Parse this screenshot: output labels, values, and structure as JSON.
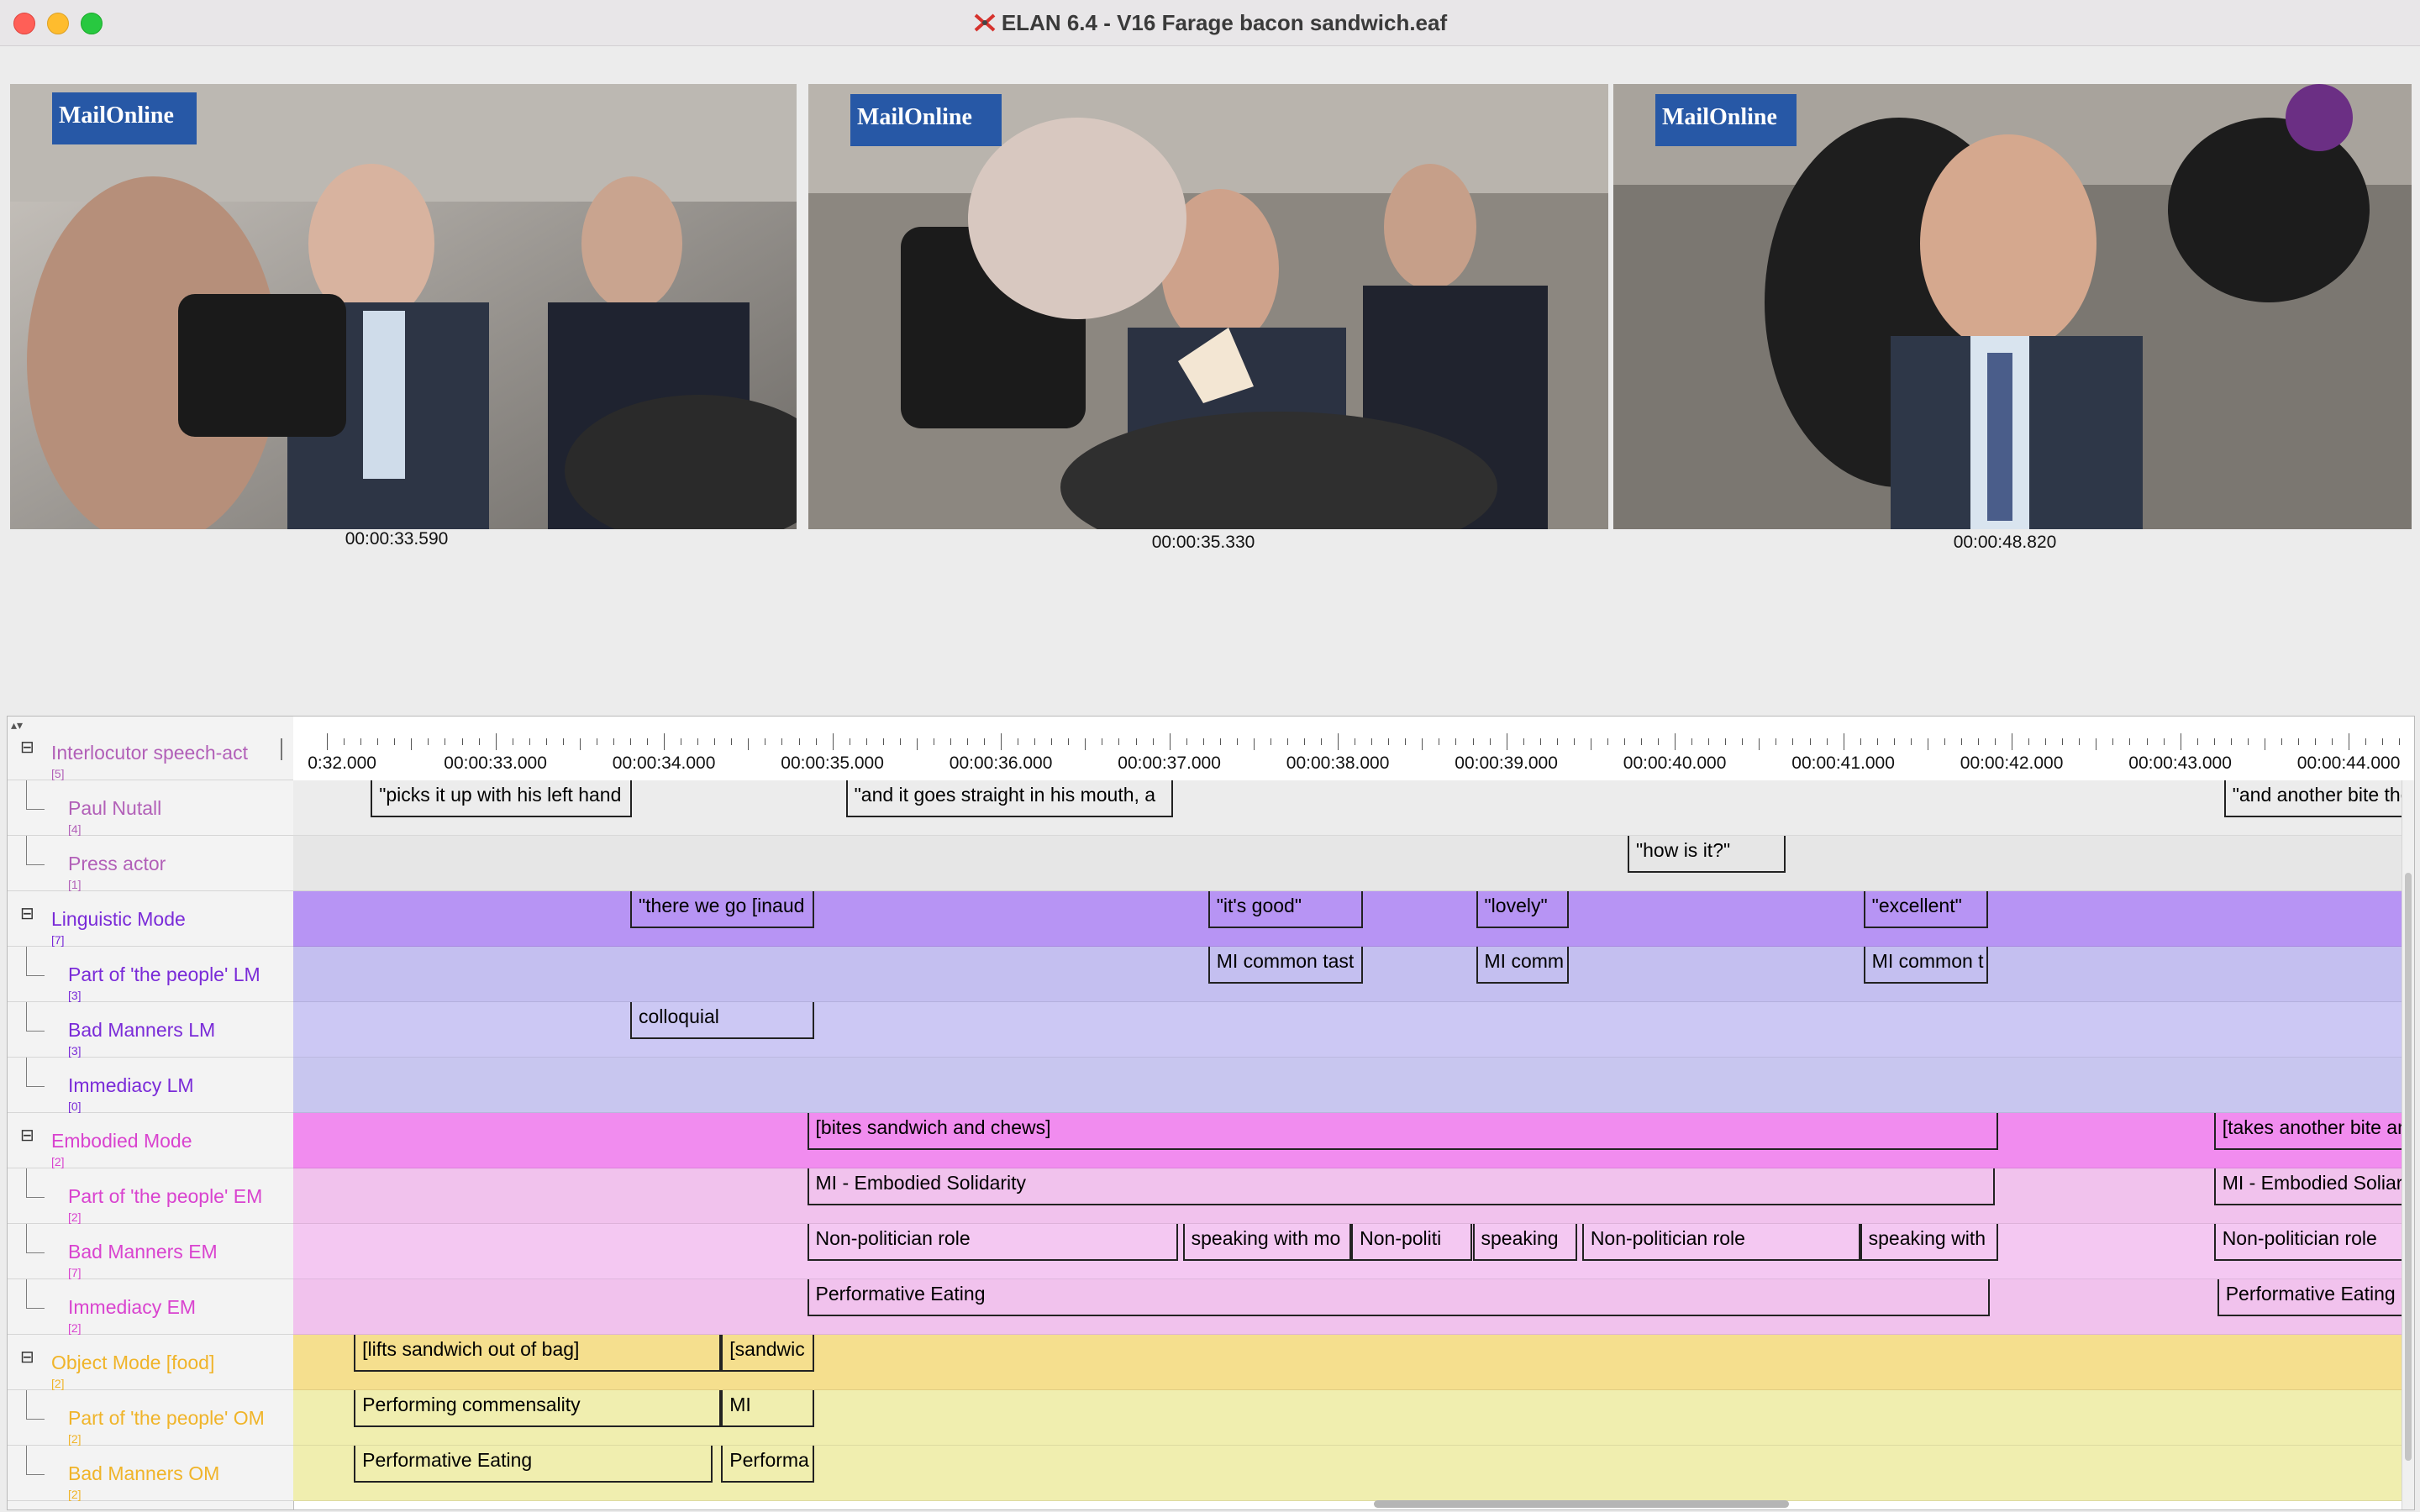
{
  "window": {
    "title": "ELAN 6.4 - V16 Farage bacon sandwich.eaf",
    "app_icon": "elan-icon"
  },
  "videos": [
    {
      "timecode": "00:00:33.590",
      "watermark": "MailOnline"
    },
    {
      "timecode": "00:00:35.330",
      "watermark": "MailOnline"
    },
    {
      "timecode": "00:00:48.820",
      "watermark": "MailOnline"
    }
  ],
  "ruler": {
    "ticks": [
      "0:32.000",
      "00:00:33.000",
      "00:00:34.000",
      "00:00:35.000",
      "00:00:36.000",
      "00:00:37.000",
      "00:00:38.000",
      "00:00:39.000",
      "00:00:40.000",
      "00:00:41.000",
      "00:00:42.000",
      "00:00:43.000",
      "00:00:44.000"
    ]
  },
  "tiers": [
    {
      "name": "Interlocutor speech-act",
      "count": "[5]",
      "color": "#b260b8",
      "band": "#ffffff",
      "parent": true,
      "annotations": []
    },
    {
      "name": "Paul Nutall",
      "count": "[4]",
      "color": "#b260b8",
      "band": "#ececec",
      "parent": false,
      "annotations": [
        {
          "text": "\"picks it up with his left hand",
          "start": 32.26,
          "end": 33.81
        },
        {
          "text": "\"and it goes straight in his mouth, a",
          "start": 35.08,
          "end": 37.02
        },
        {
          "text": "\"and another bite the",
          "start": 43.26,
          "end": 44.42
        }
      ]
    },
    {
      "name": "Press actor",
      "count": "[1]",
      "color": "#b260b8",
      "band": "#e6e6e6",
      "parent": false,
      "annotations": [
        {
          "text": "\"how is it?\"",
          "start": 39.72,
          "end": 40.66
        }
      ]
    },
    {
      "name": "Linguistic Mode",
      "count": "[7]",
      "color": "#7a2bd8",
      "band": "#b794f4",
      "parent": true,
      "annotations": [
        {
          "text": "\"there we go [inaud",
          "start": 33.8,
          "end": 34.89
        },
        {
          "text": "\"it's good\"",
          "start": 37.23,
          "end": 38.15
        },
        {
          "text": "\"lovely\"",
          "start": 38.82,
          "end": 39.37
        },
        {
          "text": "\"excellent\"",
          "start": 41.12,
          "end": 41.86
        }
      ]
    },
    {
      "name": "Part of 'the people' LM",
      "count": "[3]",
      "color": "#7a2bd8",
      "band": "#c4bff0",
      "parent": false,
      "annotations": [
        {
          "text": "MI common tast",
          "start": 37.23,
          "end": 38.15
        },
        {
          "text": "MI comm",
          "start": 38.82,
          "end": 39.37
        },
        {
          "text": "MI common t",
          "start": 41.12,
          "end": 41.86
        }
      ]
    },
    {
      "name": "Bad Manners LM",
      "count": "[3]",
      "color": "#7a2bd8",
      "band": "#ccc8f4",
      "parent": false,
      "annotations": [
        {
          "text": "colloquial",
          "start": 33.8,
          "end": 34.89
        }
      ]
    },
    {
      "name": "Immediacy LM",
      "count": "[0]",
      "color": "#7a2bd8",
      "band": "#c8c6ef",
      "parent": false,
      "annotations": []
    },
    {
      "name": "Embodied Mode",
      "count": "[2]",
      "color": "#d943cf",
      "band": "#f18cef",
      "parent": true,
      "annotations": [
        {
          "text": "[bites sandwich and chews]",
          "start": 34.85,
          "end": 41.92
        },
        {
          "text": "[takes another bite and chews",
          "start": 43.2,
          "end": 44.6
        }
      ]
    },
    {
      "name": "Part of 'the people' EM",
      "count": "[2]",
      "color": "#d943cf",
      "band": "#f1c2ed",
      "parent": false,
      "annotations": [
        {
          "text": "MI - Embodied Solidarity",
          "start": 34.85,
          "end": 41.9
        },
        {
          "text": "MI - Embodied Soliarity",
          "start": 43.2,
          "end": 44.6
        }
      ]
    },
    {
      "name": "Bad Manners EM",
      "count": "[7]",
      "color": "#d943cf",
      "band": "#f4c8f2",
      "parent": false,
      "annotations": [
        {
          "text": "Non-politician role",
          "start": 34.85,
          "end": 37.05
        },
        {
          "text": "speaking with mo",
          "start": 37.08,
          "end": 38.08
        },
        {
          "text": "Non-politi",
          "start": 38.08,
          "end": 38.8
        },
        {
          "text": "speaking",
          "start": 38.8,
          "end": 39.42
        },
        {
          "text": "Non-politician role",
          "start": 39.45,
          "end": 41.1
        },
        {
          "text": "speaking with",
          "start": 41.1,
          "end": 41.92
        },
        {
          "text": "Non-politician role",
          "start": 43.2,
          "end": 44.6
        }
      ]
    },
    {
      "name": "Immediacy EM",
      "count": "[2]",
      "color": "#d943cf",
      "band": "#f1c2ed",
      "parent": false,
      "annotations": [
        {
          "text": "Performative Eating",
          "start": 34.85,
          "end": 41.87
        },
        {
          "text": "Performative Eating",
          "start": 43.22,
          "end": 44.6
        }
      ]
    },
    {
      "name": "Object Mode [food]",
      "count": "[2]",
      "color": "#f0b429",
      "band": "#f5df8e",
      "parent": true,
      "annotations": [
        {
          "text": "[lifts sandwich out of bag]",
          "start": 32.16,
          "end": 34.34
        },
        {
          "text": "[sandwic",
          "start": 34.34,
          "end": 34.89
        }
      ]
    },
    {
      "name": "Part of 'the people' OM",
      "count": "[2]",
      "color": "#f0b429",
      "band": "#f0eeaf",
      "parent": false,
      "annotations": [
        {
          "text": "Performing commensality",
          "start": 32.16,
          "end": 34.34
        },
        {
          "text": "MI",
          "start": 34.34,
          "end": 34.89
        }
      ]
    },
    {
      "name": "Bad Manners OM",
      "count": "[2]",
      "color": "#f0b429",
      "band": "#f0eeaf",
      "parent": false,
      "annotations": [
        {
          "text": "Performative Eating",
          "start": 32.16,
          "end": 34.29
        },
        {
          "text": "Performa",
          "start": 34.34,
          "end": 34.89
        }
      ]
    }
  ]
}
